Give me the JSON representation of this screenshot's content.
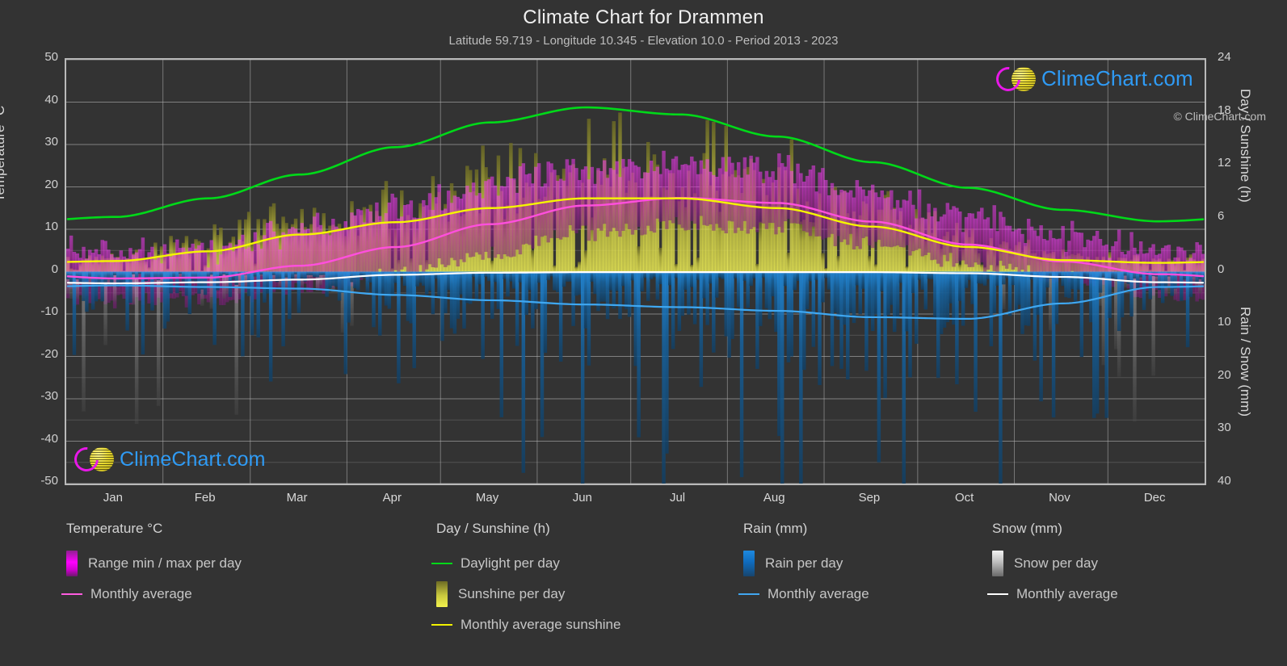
{
  "header": {
    "title": "Climate Chart for Drammen",
    "subtitle": "Latitude 59.719 - Longitude 10.345 - Elevation 10.0 - Period 2013 - 2023"
  },
  "watermark": {
    "text": "ClimeChart.com"
  },
  "copyright": "© ClimeChart.com",
  "axes": {
    "left_title": "Temperature °C",
    "right_top_title": "Day / Sunshine (h)",
    "right_bottom_title": "Rain / Snow (mm)",
    "left_ticks": [
      "50",
      "40",
      "30",
      "20",
      "10",
      "0",
      "-10",
      "-20",
      "-30",
      "-40",
      "-50"
    ],
    "right_ticks": [
      "24",
      "18",
      "12",
      "6",
      "0",
      "10",
      "20",
      "30",
      "40"
    ],
    "months": [
      "Jan",
      "Feb",
      "Mar",
      "Apr",
      "May",
      "Jun",
      "Jul",
      "Aug",
      "Sep",
      "Oct",
      "Nov",
      "Dec"
    ]
  },
  "legend": {
    "columns": [
      {
        "heading": "Temperature °C",
        "items": [
          {
            "label": "Range min / max per day",
            "swatch": "gradient-magenta",
            "color": "#ff00ff"
          },
          {
            "label": "Monthly average",
            "swatch": "line",
            "color": "#ff5ce0"
          }
        ]
      },
      {
        "heading": "Day / Sunshine (h)",
        "items": [
          {
            "label": "Daylight per day",
            "swatch": "line",
            "color": "#00d919"
          },
          {
            "label": "Sunshine per day",
            "swatch": "gradient-yellow",
            "color": "#e8e84a"
          },
          {
            "label": "Monthly average sunshine",
            "swatch": "line",
            "color": "#f2f200"
          }
        ]
      },
      {
        "heading": "Rain (mm)",
        "items": [
          {
            "label": "Rain per day",
            "swatch": "gradient-blue",
            "color": "#1e8ae0"
          },
          {
            "label": "Monthly average",
            "swatch": "line",
            "color": "#41a6f0"
          }
        ]
      },
      {
        "heading": "Snow (mm)",
        "items": [
          {
            "label": "Snow per day",
            "swatch": "gradient-gray",
            "color": "#d0d0d0"
          },
          {
            "label": "Monthly average",
            "swatch": "line",
            "color": "#ffffff"
          }
        ]
      }
    ]
  },
  "chart_data": {
    "type": "line",
    "title": "Climate Chart for Drammen",
    "subtitle": "Latitude 59.719 - Longitude 10.345 - Elevation 10.0 - Period 2013 - 2023",
    "xlabel": "",
    "ylabel": "Temperature °C",
    "ylim": [
      -50,
      50
    ],
    "y2lim_day": [
      0,
      24
    ],
    "y2lim_precip": [
      0,
      40
    ],
    "grid": true,
    "legend_position": "below",
    "categories": [
      "Jan",
      "Feb",
      "Mar",
      "Apr",
      "May",
      "Jun",
      "Jul",
      "Aug",
      "Sep",
      "Oct",
      "Nov",
      "Dec"
    ],
    "series": [
      {
        "name": "Daylight per day",
        "unit": "h",
        "color": "#00d919",
        "values": [
          6.2,
          8.3,
          11.0,
          14.1,
          16.9,
          18.6,
          17.8,
          15.3,
          12.4,
          9.5,
          7.0,
          5.7
        ]
      },
      {
        "name": "Monthly average sunshine",
        "unit": "h",
        "color": "#f2f200",
        "values": [
          1.2,
          2.3,
          4.2,
          5.6,
          7.2,
          8.3,
          8.3,
          7.2,
          5.1,
          2.8,
          1.3,
          1.0
        ]
      },
      {
        "name": "Monthly average temperature",
        "unit": "°C",
        "color": "#ff5ce0",
        "values": [
          -1.6,
          -1.4,
          1.4,
          5.8,
          11.2,
          15.6,
          17.4,
          16.2,
          11.8,
          6.4,
          2.4,
          -0.6
        ]
      },
      {
        "name": "Monthly average rain",
        "unit": "mm",
        "color": "#41a6f0",
        "values": [
          2.6,
          2.9,
          3.2,
          4.4,
          5.4,
          6.2,
          6.7,
          7.4,
          8.6,
          8.9,
          6.0,
          2.9
        ]
      },
      {
        "name": "Monthly average snow",
        "unit": "mm",
        "color": "#ffffff",
        "values": [
          2.2,
          2.0,
          1.5,
          0.6,
          0.2,
          0.1,
          0.1,
          0.1,
          0.1,
          0.3,
          1.0,
          2.0
        ]
      },
      {
        "name": "Temperature range max per day",
        "unit": "°C",
        "color": "#ff00ff",
        "values": [
          3.0,
          3.4,
          7.5,
          13.4,
          19.0,
          22.4,
          23.8,
          22.2,
          17.0,
          11.0,
          6.4,
          3.2
        ]
      },
      {
        "name": "Temperature range min per day",
        "unit": "°C",
        "color": "#a000a0",
        "values": [
          -5.6,
          -5.6,
          -3.0,
          0.5,
          5.4,
          10.2,
          12.4,
          11.4,
          7.6,
          3.0,
          -0.8,
          -4.2
        ]
      }
    ]
  }
}
